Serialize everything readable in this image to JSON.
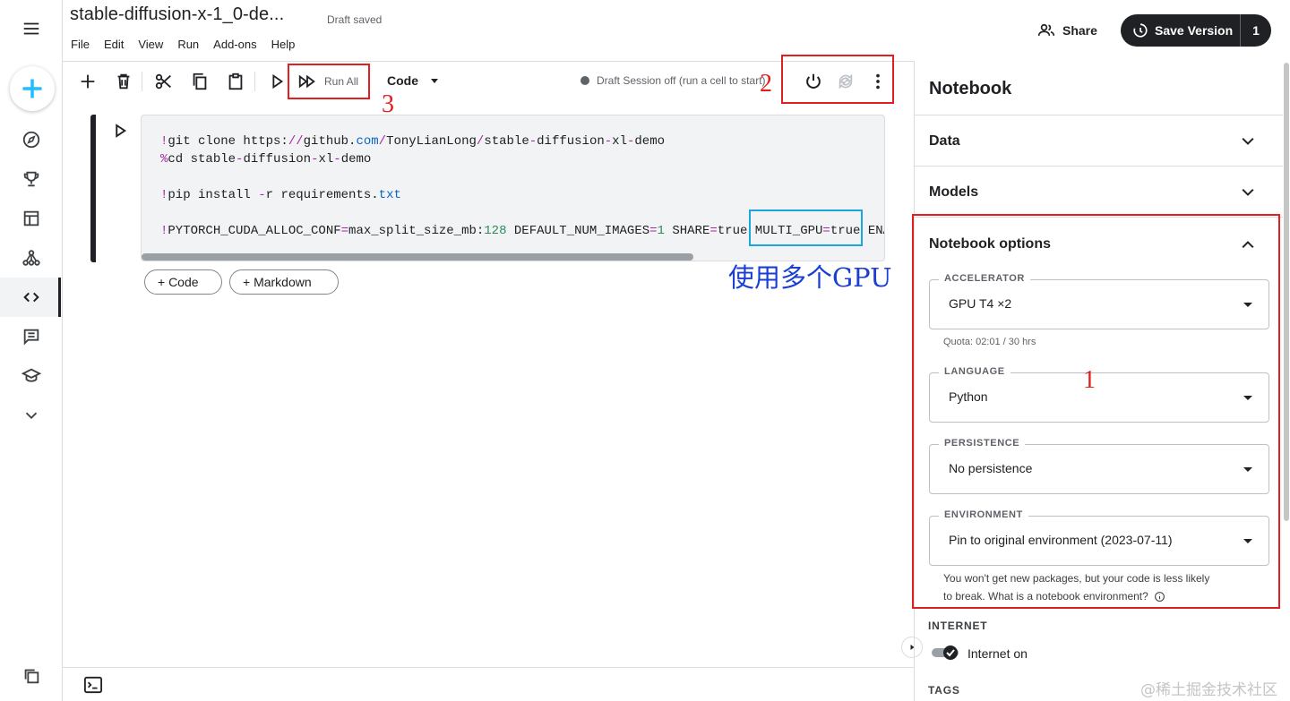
{
  "notebook": {
    "title": "stable-diffusion-x-1_0-de...",
    "save_status": "Draft saved"
  },
  "menu": [
    "File",
    "Edit",
    "View",
    "Run",
    "Add-ons",
    "Help"
  ],
  "header": {
    "share_label": "Share",
    "save_version_label": "Save Version",
    "version_count": "1"
  },
  "toolbar": {
    "run_all_label": "Run All",
    "cell_type": "Code",
    "session_status": "Draft Session off (run a cell to start)"
  },
  "cell": {
    "lines": [
      "!git clone https://github.com/TonyLianLong/stable-diffusion-xl-demo",
      "%cd stable-diffusion-xl-demo",
      "",
      "!pip install -r requirements.txt",
      "",
      "!PYTORCH_CUDA_ALLOC_CONF=max_split_size_mb:128 DEFAULT_NUM_IMAGES=1 SHARE=true MULTI_GPU=true ENA"
    ],
    "add_code_label": "+ Code",
    "add_markdown_label": "+ Markdown"
  },
  "annotations": {
    "gpu_note": "使用多个GPU",
    "marker_1": "1",
    "marker_2": "2",
    "marker_3": "3",
    "box_color": "#e02020",
    "highlight_color": "#1aa7e0",
    "note_color": "#1a3fd1"
  },
  "panel": {
    "title": "Notebook",
    "sections": {
      "data": "Data",
      "models": "Models",
      "notebook_options": "Notebook options"
    },
    "accelerator": {
      "label": "ACCELERATOR",
      "value": "GPU T4 ×2",
      "quota": "Quota: 02:01 / 30 hrs"
    },
    "language": {
      "label": "LANGUAGE",
      "value": "Python"
    },
    "persistence": {
      "label": "PERSISTENCE",
      "value": "No persistence"
    },
    "environment": {
      "label": "ENVIRONMENT",
      "value": "Pin to original environment (2023-07-11)",
      "helper_line1": "You won't get new packages, but your code is less likely",
      "helper_line2": "to break. What is a notebook environment?"
    },
    "internet": {
      "label": "INTERNET",
      "value": "Internet on",
      "enabled": true
    },
    "tags_label": "TAGS"
  },
  "watermark": "@稀土掘金技术社区",
  "colors": {
    "brand_plus": "#20beff",
    "dark": "#202124"
  }
}
